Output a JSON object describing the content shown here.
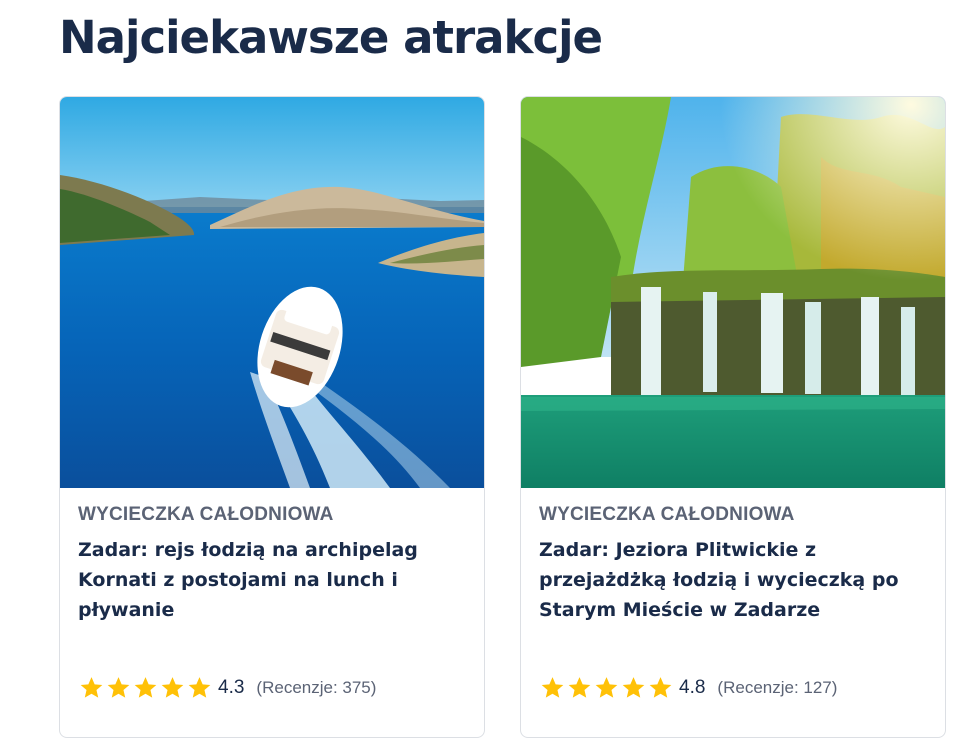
{
  "section": {
    "title": "Najciekawsze atrakcje"
  },
  "colors": {
    "star": "#ffc107",
    "title_text": "#1a2b49",
    "muted_text": "#5b6375",
    "card_border": "#dcdfe4"
  },
  "cards": [
    {
      "image_icon": "boat-archipelago-photo",
      "category": "WYCIECZKA CAŁODNIOWA",
      "title": "Zadar: rejs łodzią na archipelag Kornati z postojami na lunch i pływanie",
      "stars": 5,
      "rating": "4.3",
      "reviews": "(Recenzje: 375)"
    },
    {
      "image_icon": "waterfall-lake-photo",
      "category": "WYCIECZKA CAŁODNIOWA",
      "title": "Zadar: Jeziora Plitwickie z przejażdżką łodzią i wycieczką po Starym Mieście w Zadarze",
      "stars": 5,
      "rating": "4.8",
      "reviews": "(Recenzje: 127)"
    }
  ]
}
